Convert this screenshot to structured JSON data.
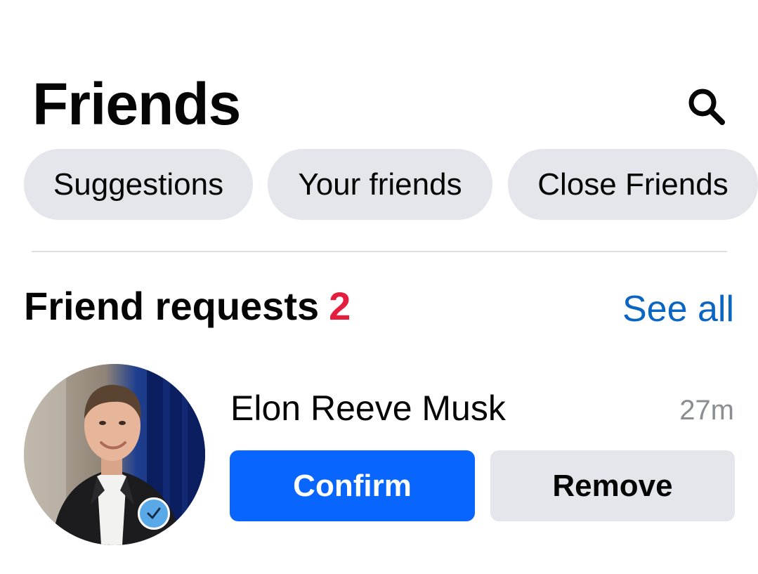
{
  "header": {
    "title": "Friends",
    "search_icon": "search-icon"
  },
  "tabs": [
    {
      "label": "Suggestions"
    },
    {
      "label": "Your friends"
    },
    {
      "label": "Close Friends"
    }
  ],
  "requests": {
    "title": "Friend requests",
    "count": "2",
    "see_all": "See all",
    "items": [
      {
        "name": "Elon Reeve Musk",
        "time": "27m",
        "confirm_label": "Confirm",
        "remove_label": "Remove",
        "verified_icon": "verified-check-icon"
      }
    ]
  },
  "colors": {
    "accent": "#0866ff",
    "link": "#0a66c2",
    "count": "#e41e3f",
    "chip_bg": "#e4e6eb"
  }
}
